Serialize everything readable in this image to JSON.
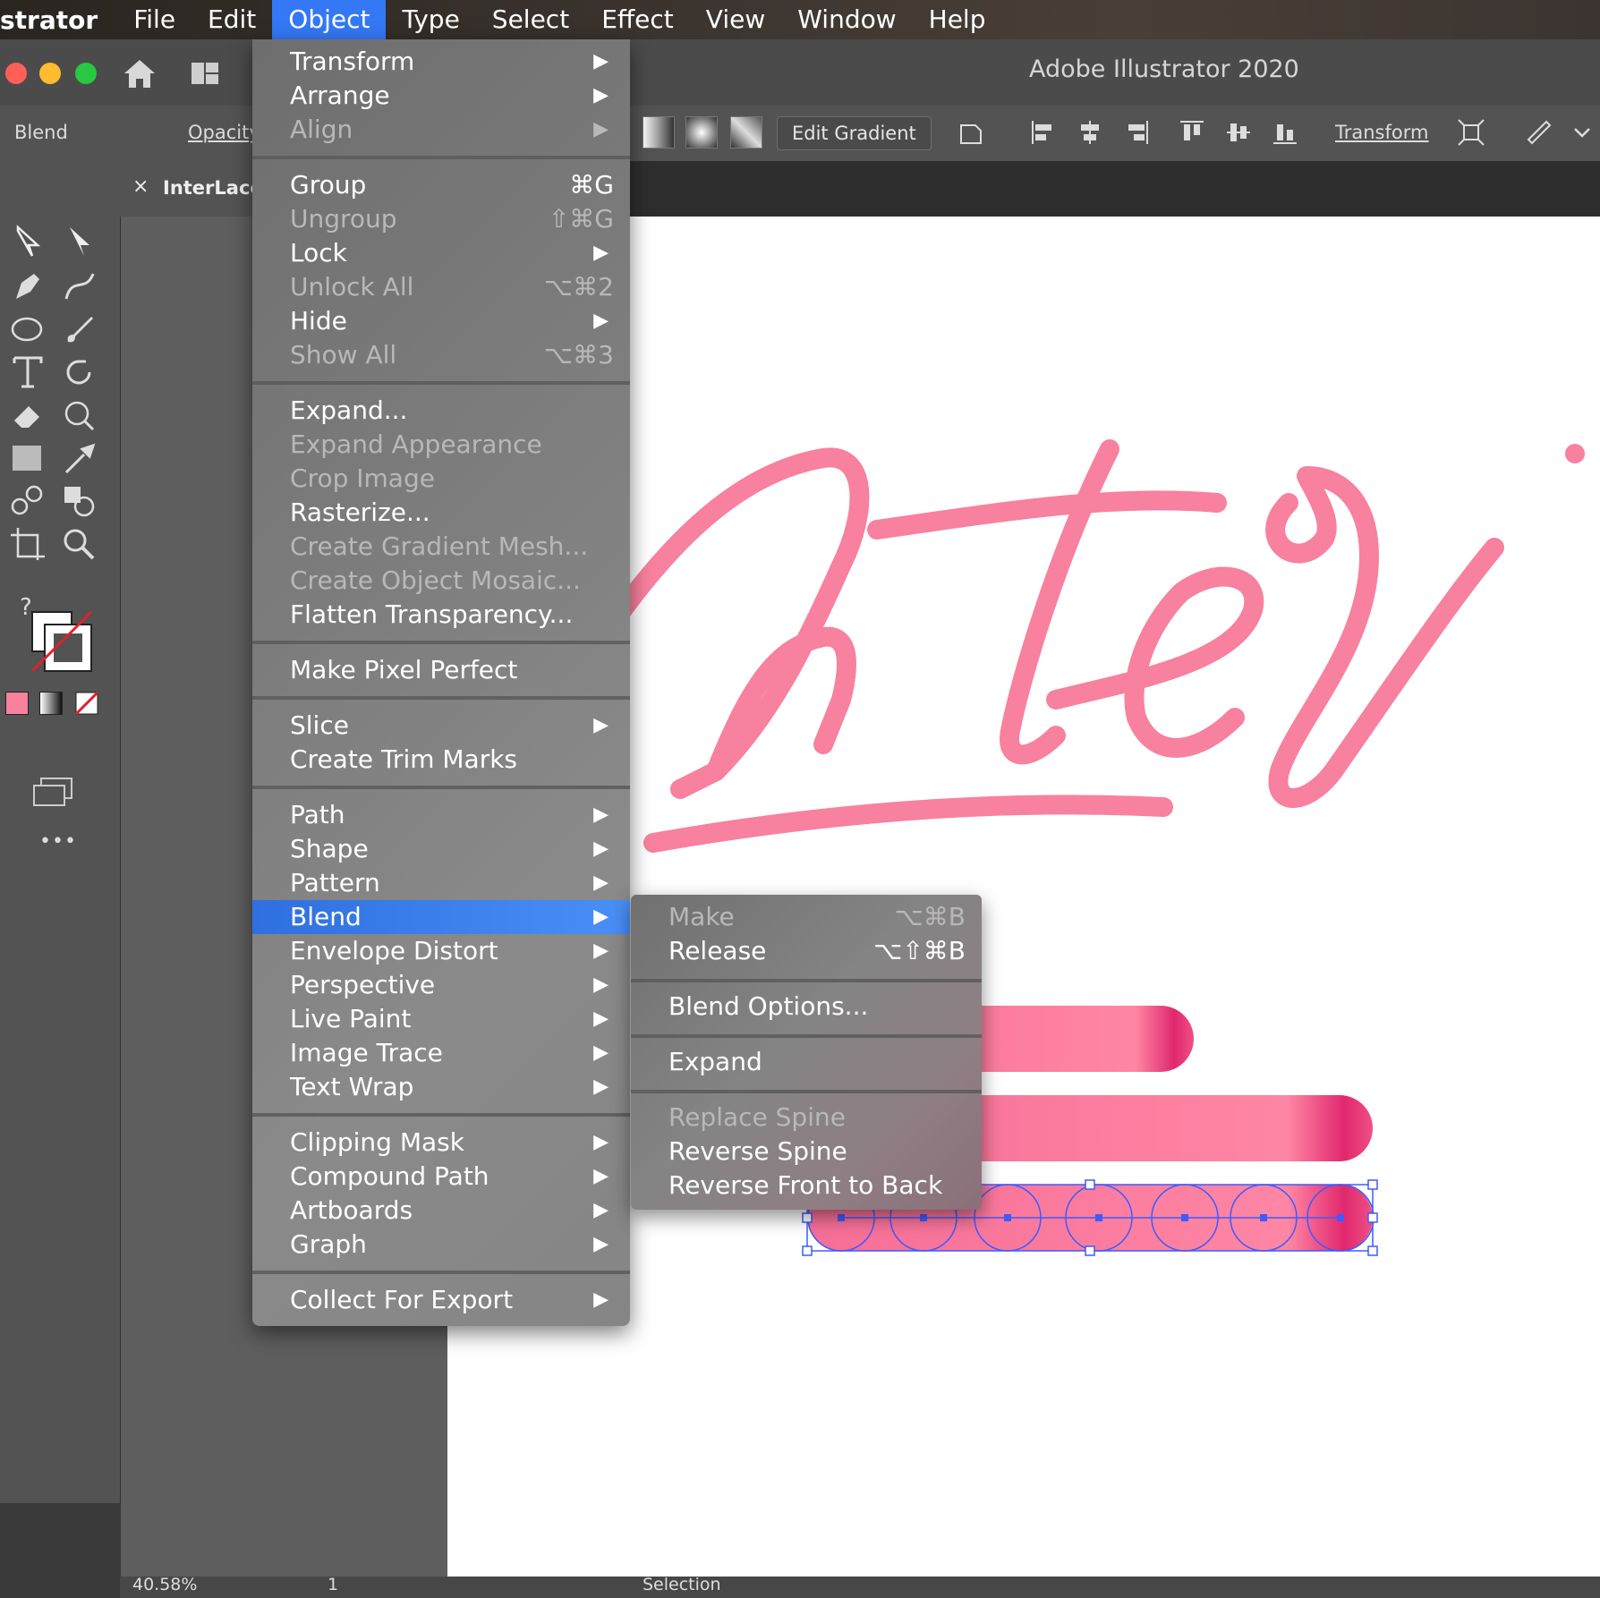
{
  "menubar": {
    "app_name": "strator",
    "items": [
      "File",
      "Edit",
      "Object",
      "Type",
      "Select",
      "Effect",
      "View",
      "Window",
      "Help"
    ]
  },
  "window": {
    "title": "Adobe Illustrator 2020"
  },
  "controlbar": {
    "object_type": "Blend",
    "opacity_label": "Opacity",
    "edit_gradient": "Edit Gradient",
    "transform": "Transform"
  },
  "document": {
    "tab_name": "InterLaced",
    "close_glyph": "×"
  },
  "status": {
    "zoom": "40.58%",
    "artboard": "1",
    "tool": "Selection"
  },
  "object_menu": {
    "items": [
      {
        "label": "Transform",
        "submenu": true
      },
      {
        "label": "Arrange",
        "submenu": true
      },
      {
        "label": "Align",
        "submenu": true,
        "disabled": true
      },
      {
        "label": "Group",
        "shortcut": "⌘G"
      },
      {
        "label": "Ungroup",
        "shortcut": "⇧⌘G",
        "disabled": true
      },
      {
        "label": "Lock",
        "submenu": true
      },
      {
        "label": "Unlock All",
        "shortcut": "⌥⌘2",
        "disabled": true
      },
      {
        "label": "Hide",
        "submenu": true
      },
      {
        "label": "Show All",
        "shortcut": "⌥⌘3",
        "disabled": true
      },
      {
        "label": "Expand..."
      },
      {
        "label": "Expand Appearance",
        "disabled": true
      },
      {
        "label": "Crop Image",
        "disabled": true
      },
      {
        "label": "Rasterize..."
      },
      {
        "label": "Create Gradient Mesh...",
        "disabled": true
      },
      {
        "label": "Create Object Mosaic...",
        "disabled": true
      },
      {
        "label": "Flatten Transparency..."
      },
      {
        "label": "Make Pixel Perfect"
      },
      {
        "label": "Slice",
        "submenu": true
      },
      {
        "label": "Create Trim Marks"
      },
      {
        "label": "Path",
        "submenu": true
      },
      {
        "label": "Shape",
        "submenu": true
      },
      {
        "label": "Pattern",
        "submenu": true
      },
      {
        "label": "Blend",
        "submenu": true,
        "highlighted": true
      },
      {
        "label": "Envelope Distort",
        "submenu": true
      },
      {
        "label": "Perspective",
        "submenu": true
      },
      {
        "label": "Live Paint",
        "submenu": true
      },
      {
        "label": "Image Trace",
        "submenu": true
      },
      {
        "label": "Text Wrap",
        "submenu": true
      },
      {
        "label": "Clipping Mask",
        "submenu": true
      },
      {
        "label": "Compound Path",
        "submenu": true
      },
      {
        "label": "Artboards",
        "submenu": true
      },
      {
        "label": "Graph",
        "submenu": true
      },
      {
        "label": "Collect For Export",
        "submenu": true
      }
    ]
  },
  "blend_submenu": {
    "items": [
      {
        "label": "Make",
        "shortcut": "⌥⌘B",
        "disabled": true
      },
      {
        "label": "Release",
        "shortcut": "⌥⇧⌘B"
      },
      {
        "label": "Blend Options..."
      },
      {
        "label": "Expand"
      },
      {
        "label": "Replace Spine",
        "disabled": true
      },
      {
        "label": "Reverse Spine"
      },
      {
        "label": "Reverse Front to Back"
      }
    ]
  },
  "tools_panel": {
    "help_glyph": "?",
    "more_glyph": "•••"
  },
  "colors": {
    "accent": "#3478f6",
    "artwork_pink": "#f7819e",
    "bar_pink": "#f66e97",
    "bar_deep": "#e0286e",
    "selection_blue": "#3d5bff"
  }
}
